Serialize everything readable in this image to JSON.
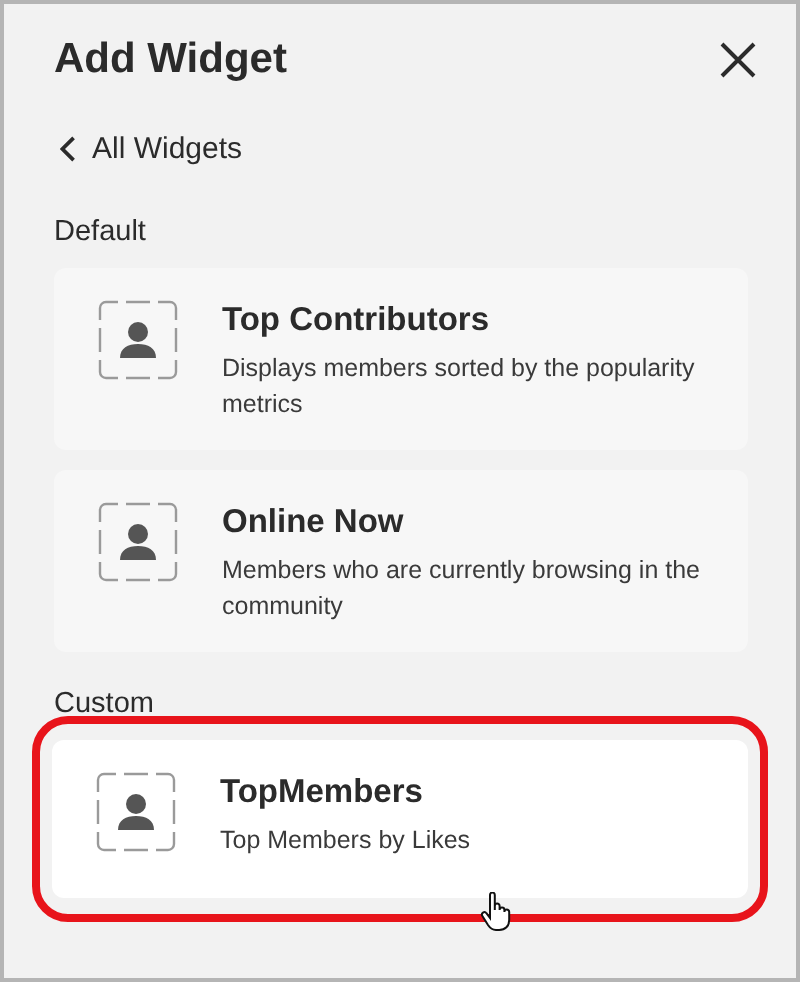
{
  "title": "Add Widget",
  "back_link": "All Widgets",
  "sections": [
    {
      "heading": "Default",
      "widgets": [
        {
          "name": "Top Contributors",
          "description": "Displays members sorted by the popularity metrics",
          "highlighted": false
        },
        {
          "name": "Online Now",
          "description": "Members who are currently browsing in the community",
          "highlighted": false
        }
      ]
    },
    {
      "heading": "Custom",
      "widgets": [
        {
          "name": "TopMembers",
          "description": "Top Members by Likes",
          "highlighted": true
        }
      ]
    }
  ]
}
